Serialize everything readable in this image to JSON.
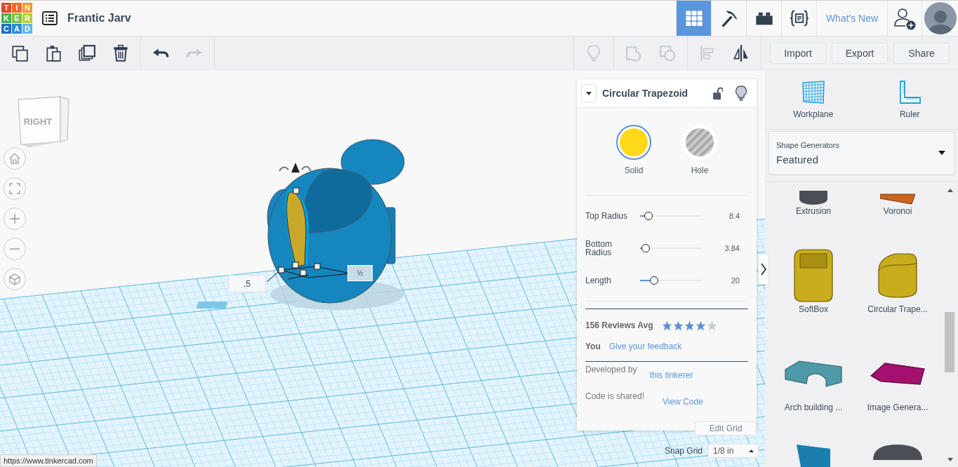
{
  "topbar": {
    "logo_tiles": [
      {
        "letter": "T",
        "color": "#e8442b"
      },
      {
        "letter": "I",
        "color": "#f26b21"
      },
      {
        "letter": "N",
        "color": "#f7962f"
      },
      {
        "letter": "K",
        "color": "#4caf50"
      },
      {
        "letter": "E",
        "color": "#7cc242"
      },
      {
        "letter": "R",
        "color": "#b9cf2f"
      },
      {
        "letter": "C",
        "color": "#1a6fc9"
      },
      {
        "letter": "A",
        "color": "#2b8bd6"
      },
      {
        "letter": "D",
        "color": "#63b3e6"
      }
    ],
    "project_title": "Frantic Jarv",
    "views": [
      {
        "kind": "grid",
        "selected": true
      },
      {
        "kind": "pickaxe",
        "selected": false
      },
      {
        "kind": "brick",
        "selected": false
      },
      {
        "kind": "code",
        "selected": false
      }
    ],
    "whats_new": "What's New"
  },
  "toolbar": {
    "edit_tools": [
      {
        "kind": "copy",
        "disabled": false
      },
      {
        "kind": "paste",
        "disabled": false
      },
      {
        "kind": "duplicate",
        "disabled": false
      },
      {
        "kind": "delete",
        "disabled": false
      }
    ],
    "history_tools": [
      {
        "kind": "undo",
        "disabled": false
      },
      {
        "kind": "redo",
        "disabled": true
      }
    ],
    "shape_tools": [
      {
        "kind": "bulb",
        "disabled": true
      },
      {
        "kind": "group",
        "disabled": true
      },
      {
        "kind": "ungroup",
        "disabled": true
      },
      {
        "kind": "align",
        "disabled": true
      },
      {
        "kind": "mirror",
        "disabled": false
      }
    ],
    "buttons": [
      "Import",
      "Export",
      "Share"
    ]
  },
  "canvas": {
    "view_cube": "RIGHT",
    "dimension_labels": [
      ".5",
      "½"
    ]
  },
  "inspector": {
    "title": "Circular Trapezoid",
    "locked": false,
    "modes": [
      {
        "kind": "solid",
        "label": "Solid",
        "selected": true
      },
      {
        "kind": "hole",
        "label": "Hole",
        "selected": false
      }
    ],
    "params": [
      {
        "name": "Top Radius",
        "level": 0.08,
        "reading": "8.4"
      },
      {
        "name": "Bottom Radius",
        "level": 0.03,
        "reading": "3.84"
      },
      {
        "name": "Length",
        "level": 0.18,
        "reading": "20"
      }
    ],
    "reviews": {
      "summary": "156 Reviews Avg",
      "stars": 4
    },
    "you_label": "You",
    "feedback_link": "Give your feedback",
    "developed_label": "Developed by",
    "developer_link": "this tinkerer",
    "code_label": "Code is shared!",
    "code_link": "View Code"
  },
  "grid_controls": {
    "edit_grid": "Edit Grid",
    "snap_label": "Snap Grid",
    "snap_value": "1/8 in"
  },
  "status_url": "https://www.tinkercad.com",
  "sidebar": {
    "tools": [
      {
        "kind": "workplane",
        "label": "Workplane"
      },
      {
        "kind": "ruler",
        "label": "Ruler"
      }
    ],
    "library": {
      "label": "Shape Generators",
      "value": "Featured"
    },
    "shapes": [
      {
        "kind": "cylinder-base",
        "label": "Extrusion",
        "color": "#4a4f55"
      },
      {
        "kind": "plate-corner",
        "label": "Voronoi",
        "color": "#c8641e"
      },
      {
        "kind": "softbox",
        "label": "SoftBox",
        "color": "#c9ad1c"
      },
      {
        "kind": "trapezoid",
        "label": "Circular Trape...",
        "color": "#c9ad1c"
      },
      {
        "kind": "arch",
        "label": "Arch building ...",
        "color": "#4f9aa8"
      },
      {
        "kind": "plate",
        "label": "Image Genera...",
        "color": "#a3106e"
      },
      {
        "kind": "wedge-top",
        "color": "#1a7fb0"
      },
      {
        "kind": "oval-top",
        "color": "#4a4f55"
      }
    ]
  }
}
